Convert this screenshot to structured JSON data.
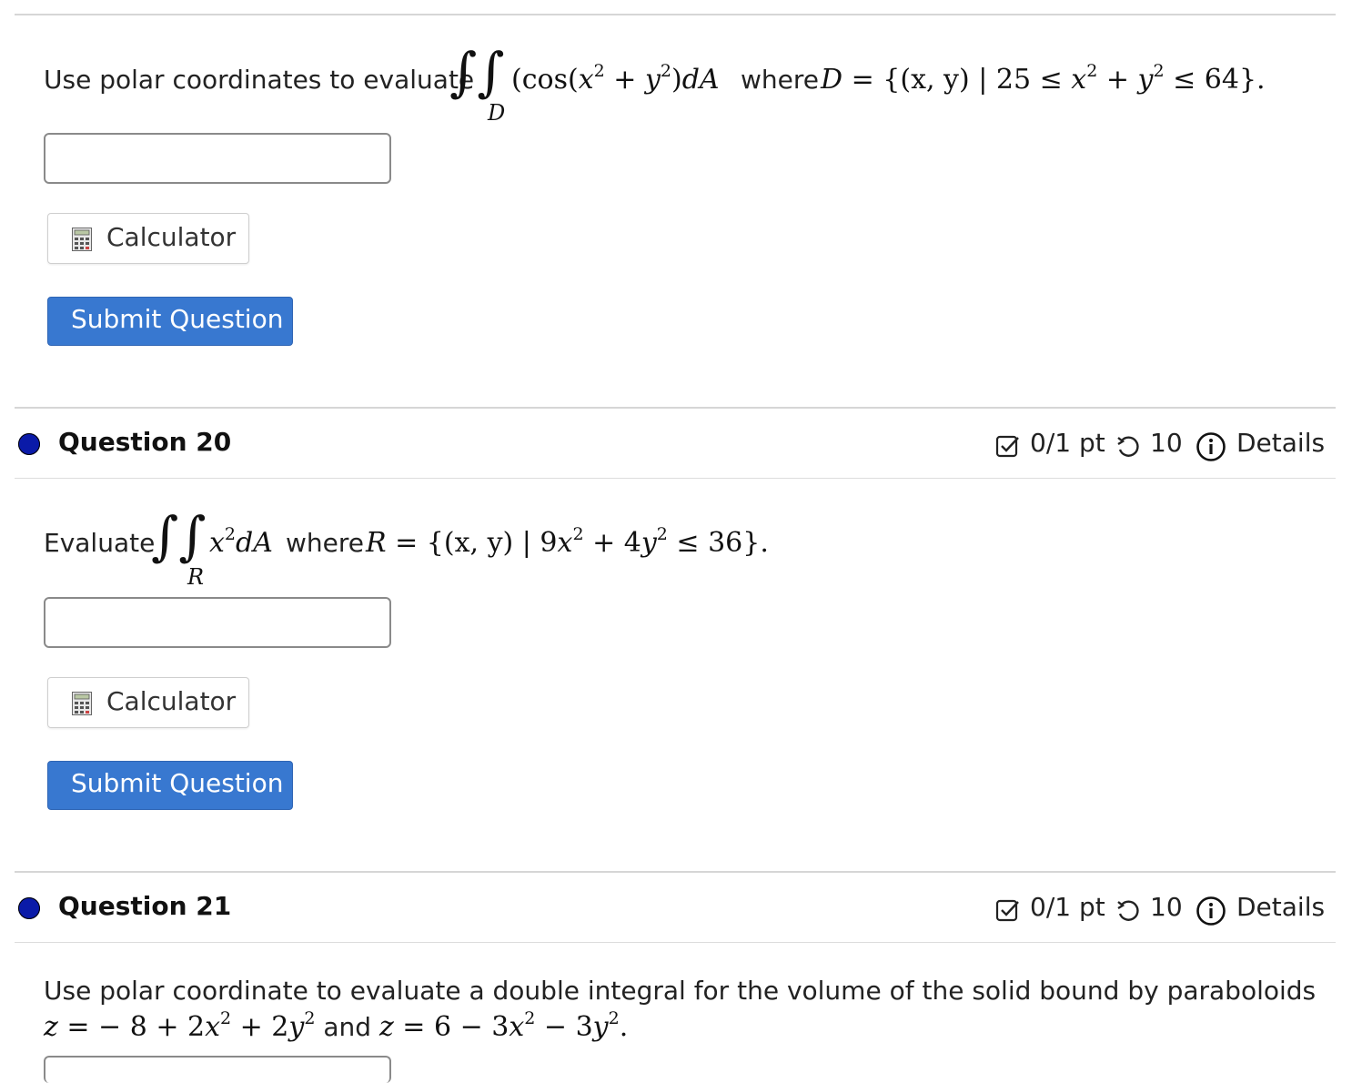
{
  "q19": {
    "prompt_prefix": "Use polar coordinates to evaluate",
    "integral_region": "D",
    "integrand_cos": "cos",
    "integrand_x": "x",
    "sq": "2",
    "integrand_y": "y",
    "dA": "dA",
    "where": "where",
    "region_var": "D",
    "set_prefix": " = {(x, y) | 25 ≤ ",
    "set_x": "x",
    "set_mid": " + ",
    "set_y": "y",
    "set_suffix": " ≤ 64}.",
    "answer_value": "",
    "calculator_label": "Calculator",
    "submit_label": "Submit Question"
  },
  "q20": {
    "title": "Question 20",
    "score": "0/1 pt",
    "retries": "10",
    "details": "Details",
    "prompt_prefix": "Evaluate",
    "integral_region": "R",
    "integrand": "x",
    "sq": "2",
    "dA": "dA",
    "where": "where",
    "region_var": "R",
    "set_prefix": " = {(x, y) | 9",
    "set_x": "x",
    "set_mid": " + 4",
    "set_y": "y",
    "set_suffix": " ≤ 36}.",
    "answer_value": "",
    "calculator_label": "Calculator",
    "submit_label": "Submit Question"
  },
  "q21": {
    "title": "Question 21",
    "score": "0/1 pt",
    "retries": "10",
    "details": "Details",
    "prompt_line1": "Use polar coordinate to evaluate a double integral for the volume of the solid bound by paraboloids",
    "eq1_lhs": "z",
    "eq1_rhs_a": " =  − 8 + 2",
    "x": "x",
    "sq": "2",
    "eq1_rhs_b": " + 2",
    "y": "y",
    "and": "and",
    "eq2_rhs_a": " = 6 − 3",
    "eq2_rhs_b": " − 3",
    "eq2_end": "."
  }
}
